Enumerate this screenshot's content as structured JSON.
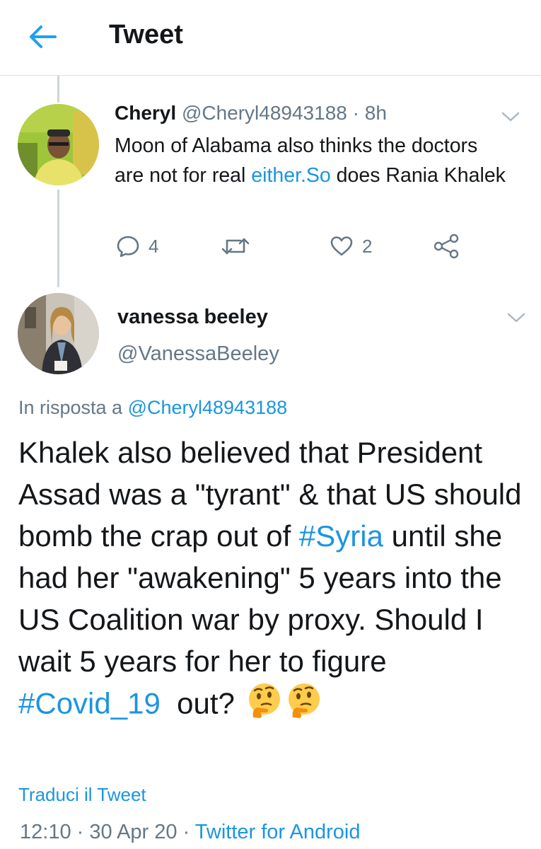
{
  "header": {
    "title": "Tweet",
    "back_icon": "arrow-left-icon"
  },
  "colors": {
    "link": "#1b95e0",
    "muted": "#657786",
    "text": "#14171a"
  },
  "tweet1": {
    "name": "Cheryl",
    "handle": "@Cheryl48943188",
    "separator": " · ",
    "time": "8h",
    "text_before_link": "Moon of Alabama also thinks the doctors are not for real ",
    "link": "either.So",
    "text_after_link": " does Rania Khalek",
    "replies": "4",
    "likes": "2"
  },
  "tweet2": {
    "name": "vanessa beeley",
    "handle": "@VanessaBeeley",
    "reply_prefix": "In risposta a ",
    "reply_handle": "@Cheryl48943188",
    "text1": "Khalek also believed that President Assad was a \"tyrant\" & that US should bomb the crap out of ",
    "hashtag1": "#Syria",
    "text2": " until she had her \"awakening\" 5 years into the US Coalition war by proxy. Should I wait 5 years for her to figure ",
    "hashtag2": "#Covid_19",
    "text3": "  out? ",
    "emoji": "thinking-face-emoji",
    "translate": "Traduci il Tweet",
    "time": "12:10",
    "date": "30 Apr 20",
    "sep": " · ",
    "client": "Twitter for Android"
  }
}
